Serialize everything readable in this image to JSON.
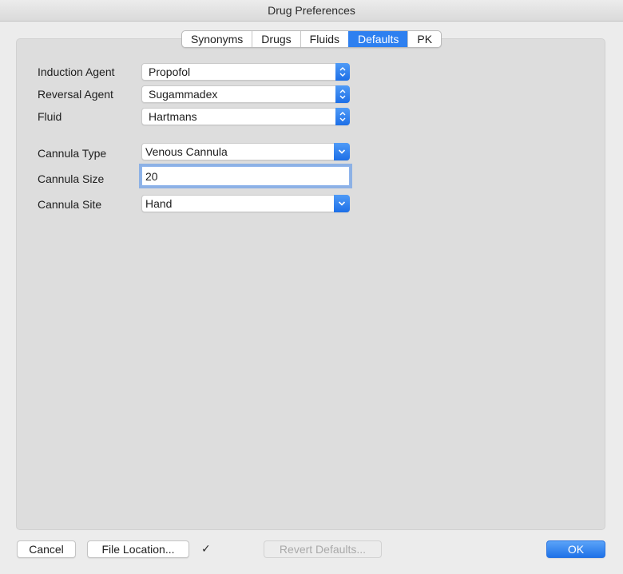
{
  "window": {
    "title": "Drug Preferences"
  },
  "tabs": [
    {
      "label": "Synonyms"
    },
    {
      "label": "Drugs"
    },
    {
      "label": "Fluids"
    },
    {
      "label": "Defaults",
      "active": true
    },
    {
      "label": "PK"
    }
  ],
  "form": {
    "induction_agent": {
      "label": "Induction Agent",
      "value": "Propofol"
    },
    "reversal_agent": {
      "label": "Reversal Agent",
      "value": "Sugammadex"
    },
    "fluid": {
      "label": "Fluid",
      "value": "Hartmans"
    },
    "cannula_type": {
      "label": "Cannula Type",
      "value": "Venous Cannula"
    },
    "cannula_size": {
      "label": "Cannula Size",
      "value": "20"
    },
    "cannula_site": {
      "label": "Cannula Site",
      "value": "Hand"
    }
  },
  "footer": {
    "cancel_label": "Cancel",
    "file_location_label": "File Location...",
    "checkmark": "✓",
    "revert_label": "Revert Defaults...",
    "ok_label": "OK"
  },
  "colors": {
    "accent": "#2e80f0"
  },
  "icons": {
    "stepper": "up-down-chevron-icon",
    "popup": "chevron-down-icon"
  }
}
